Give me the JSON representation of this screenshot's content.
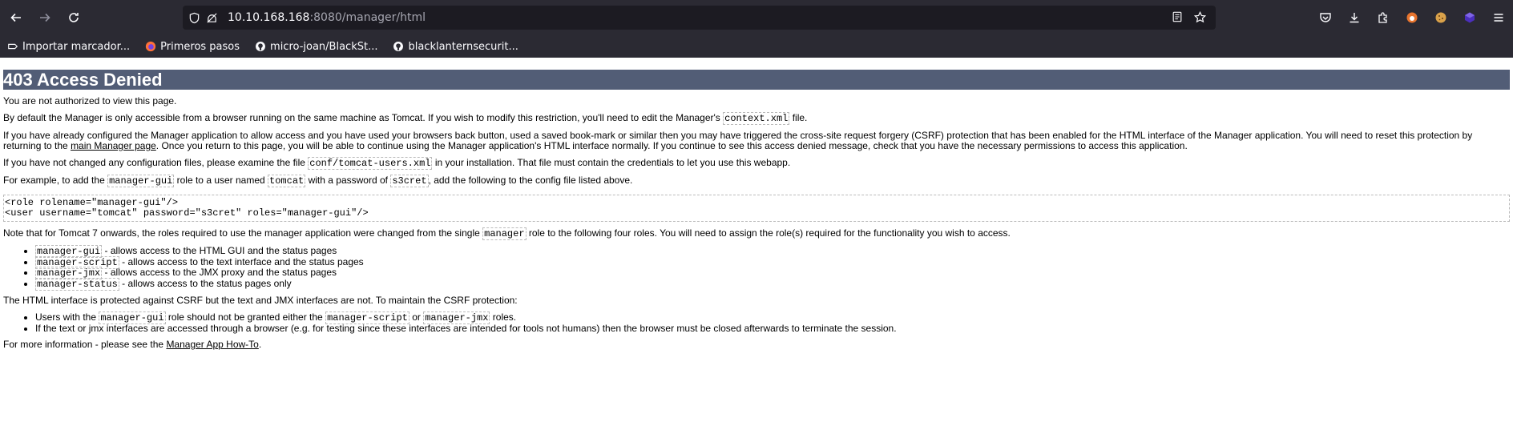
{
  "browser": {
    "url_host": "10.10.168.168",
    "url_rest": ":8080/manager/html",
    "bookmarks": [
      {
        "label": "Importar marcador...",
        "icon": "import-icon"
      },
      {
        "label": "Primeros pasos",
        "icon": "firefox-icon"
      },
      {
        "label": "micro-joan/BlackSt...",
        "icon": "github-icon"
      },
      {
        "label": "blacklanternsecurit...",
        "icon": "github-icon"
      }
    ]
  },
  "page": {
    "title": "403 Access Denied",
    "p1": "You are not authorized to view this page.",
    "p2a": "By default the Manager is only accessible from a browser running on the same machine as Tomcat. If you wish to modify this restriction, you'll need to edit the Manager's ",
    "p2code": "context.xml",
    "p2b": " file.",
    "p3a": "If you have already configured the Manager application to allow access and you have used your browsers back button, used a saved book-mark or similar then you may have triggered the cross-site request forgery (CSRF) protection that has been enabled for the HTML interface of the Manager application. You will need to reset this protection by returning to the ",
    "p3link": "main Manager page",
    "p3b": ". Once you return to this page, you will be able to continue using the Manager application's HTML interface normally. If you continue to see this access denied message, check that you have the necessary permissions to access this application.",
    "p4a": "If you have not changed any configuration files, please examine the file ",
    "p4code": "conf/tomcat-users.xml",
    "p4b": " in your installation. That file must contain the credentials to let you use this webapp.",
    "p5a": "For example, to add the ",
    "p5code1": "manager-gui",
    "p5b": " role to a user named ",
    "p5code2": "tomcat",
    "p5c": " with a password of ",
    "p5code3": "s3cret",
    "p5d": ", add the following to the config file listed above.",
    "pre_line1": "<role rolename=\"manager-gui\"/>",
    "pre_line2": "<user username=\"tomcat\" password=\"s3cret\" roles=\"manager-gui\"/>",
    "p6a": "Note that for Tomcat 7 onwards, the roles required to use the manager application were changed from the single ",
    "p6code": "manager",
    "p6b": " role to the following four roles. You will need to assign the role(s) required for the functionality you wish to access.",
    "roles": [
      {
        "code": "manager-gui",
        "text": " - allows access to the HTML GUI and the status pages"
      },
      {
        "code": "manager-script",
        "text": " - allows access to the text interface and the status pages"
      },
      {
        "code": "manager-jmx",
        "text": " - allows access to the JMX proxy and the status pages"
      },
      {
        "code": "manager-status",
        "text": " - allows access to the status pages only"
      }
    ],
    "p7": "The HTML interface is protected against CSRF but the text and JMX interfaces are not. To maintain the CSRF protection:",
    "csrf1a": "Users with the ",
    "csrf1code1": "manager-gui",
    "csrf1b": " role should not be granted either the ",
    "csrf1code2": "manager-script",
    "csrf1c": " or ",
    "csrf1code3": "manager-jmx",
    "csrf1d": " roles.",
    "csrf2": "If the text or jmx interfaces are accessed through a browser (e.g. for testing since these interfaces are intended for tools not humans) then the browser must be closed afterwards to terminate the session.",
    "p8a": "For more information - please see the ",
    "p8link": "Manager App How-To",
    "p8b": "."
  }
}
